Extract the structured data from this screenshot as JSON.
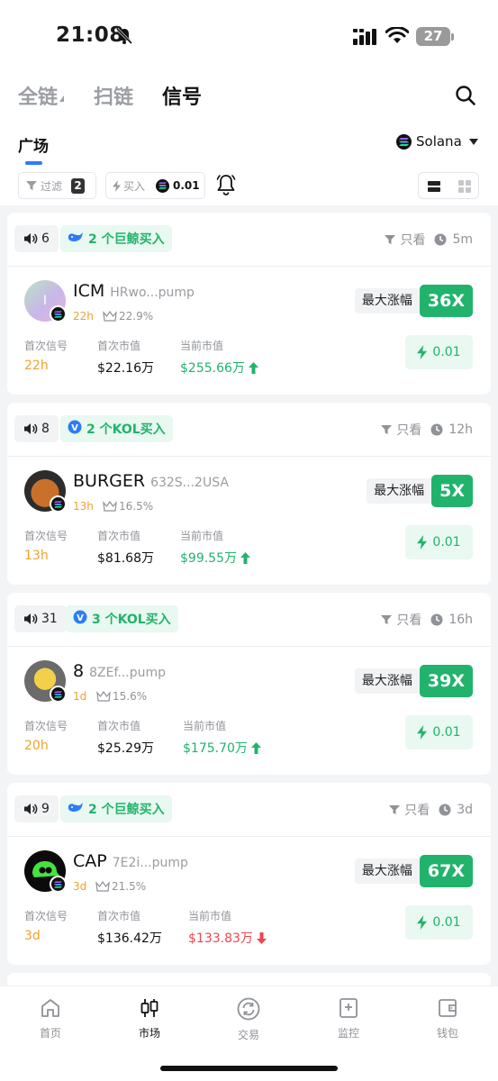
{
  "status_bar": {
    "time": "21:08",
    "battery": "27"
  },
  "top_tabs": [
    {
      "label": "全链",
      "active": false
    },
    {
      "label": "扫链",
      "active": false
    },
    {
      "label": "信号",
      "active": true
    }
  ],
  "subnav": {
    "plaza": "广场",
    "chain": "Solana",
    "filter_label": "过滤",
    "filter_count": "2",
    "buy_label": "买入",
    "buy_amount": "0.01"
  },
  "cards": [
    {
      "speaker_count": "6",
      "tag": "2 个巨鲸买入",
      "tag_icon": "whale-icon",
      "only_label": "只看",
      "time_ago": "5m",
      "avatar_letter": "I",
      "symbol": "ICM",
      "address": "HRwo...pump",
      "age": "22h",
      "holder_pct": "22.9%",
      "labels": [
        "首次信号",
        "首次市值",
        "当前市值"
      ],
      "first_signal": "22h",
      "first_mcap": "$22.16万",
      "current_mcap": "$255.66万",
      "trend": "up",
      "max_label": "最大涨幅",
      "max_gain": "36X",
      "buy_amount": "0.01"
    },
    {
      "speaker_count": "8",
      "tag": "2 个KOL买入",
      "tag_icon": "kol-icon",
      "only_label": "只看",
      "time_ago": "12h",
      "avatar_letter": "",
      "symbol": "BURGER",
      "address": "632S...2USA",
      "age": "13h",
      "holder_pct": "16.5%",
      "labels": [
        "首次信号",
        "首次市值",
        "当前市值"
      ],
      "first_signal": "13h",
      "first_mcap": "$81.68万",
      "current_mcap": "$99.55万",
      "trend": "up",
      "max_label": "最大涨幅",
      "max_gain": "5X",
      "buy_amount": "0.01"
    },
    {
      "speaker_count": "31",
      "tag": "3 个KOL买入",
      "tag_icon": "kol-icon",
      "only_label": "只看",
      "time_ago": "16h",
      "avatar_letter": "",
      "symbol": "8",
      "address": "8ZEf...pump",
      "age": "1d",
      "holder_pct": "15.6%",
      "labels": [
        "首次信号",
        "首次市值",
        "当前市值"
      ],
      "first_signal": "20h",
      "first_mcap": "$25.29万",
      "current_mcap": "$175.70万",
      "trend": "up",
      "max_label": "最大涨幅",
      "max_gain": "39X",
      "buy_amount": "0.01"
    },
    {
      "speaker_count": "9",
      "tag": "2 个巨鲸买入",
      "tag_icon": "whale-icon",
      "only_label": "只看",
      "time_ago": "3d",
      "avatar_letter": "",
      "symbol": "CAP",
      "address": "7E2i...pump",
      "age": "3d",
      "holder_pct": "21.5%",
      "labels": [
        "首次信号",
        "首次市值",
        "当前市值"
      ],
      "first_signal": "3d",
      "first_mcap": "$136.42万",
      "current_mcap": "$133.83万",
      "trend": "down",
      "max_label": "最大涨幅",
      "max_gain": "67X",
      "buy_amount": "0.01"
    }
  ],
  "bottom_nav": [
    {
      "label": "首页",
      "icon": "home-icon",
      "active": false
    },
    {
      "label": "市场",
      "icon": "candlestick-icon",
      "active": true
    },
    {
      "label": "交易",
      "icon": "swap-icon",
      "active": false
    },
    {
      "label": "监控",
      "icon": "monitor-icon",
      "active": false
    },
    {
      "label": "钱包",
      "icon": "wallet-icon",
      "active": false
    }
  ],
  "colors": {
    "green": "#21b36c",
    "orange": "#f0a229",
    "red": "#f0454e",
    "blue": "#2d7cf6"
  }
}
